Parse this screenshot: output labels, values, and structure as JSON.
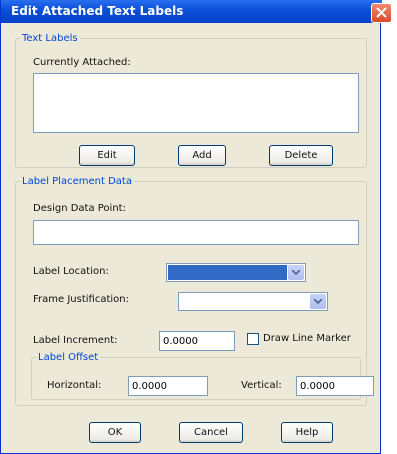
{
  "dialog": {
    "title": "Edit Attached Text Labels"
  },
  "text_labels": {
    "group_title": "Text Labels",
    "currently_attached_label": "Currently Attached:",
    "currently_attached_items": [],
    "edit_label": "Edit",
    "add_label": "Add",
    "delete_label": "Delete"
  },
  "placement": {
    "group_title": "Label Placement Data",
    "design_data_point_label": "Design Data Point:",
    "design_data_point_value": "",
    "label_location_label": "Label Location:",
    "label_location_value": "",
    "frame_justification_label": "Frame Justification:",
    "frame_justification_value": "",
    "label_increment_label": "Label Increment:",
    "label_increment_value": "0.0000",
    "draw_line_marker_label": "Draw Line Marker",
    "draw_line_marker_checked": false,
    "offset": {
      "group_title": "Label Offset",
      "horizontal_label": "Horizontal:",
      "horizontal_value": "0.0000",
      "vertical_label": "Vertical:",
      "vertical_value": "0.0000"
    }
  },
  "footer": {
    "ok_label": "OK",
    "cancel_label": "Cancel",
    "help_label": "Help"
  },
  "colors": {
    "title_bar": "#0a4ed6",
    "group_title": "#0046d5",
    "selection": "#316ac5"
  }
}
